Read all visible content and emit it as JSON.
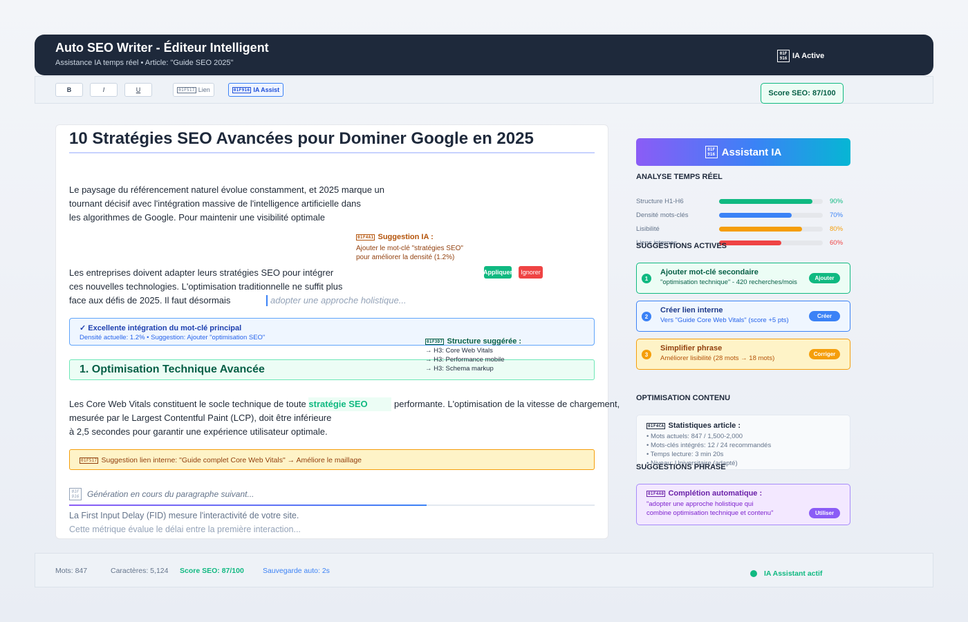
{
  "app": {
    "title": "Auto SEO Writer - Éditeur Intelligent",
    "subtitle": "Assistance IA temps réel • Article: \"Guide SEO 2025\"",
    "status_icon": "robot-icon",
    "status_glyph": "01F916",
    "status_label": "IA Active"
  },
  "toolbar": {
    "bold": "B",
    "italic": "I",
    "underline": "U",
    "link_glyph": "01F517",
    "link_label": "Lien",
    "ia_glyph": "01F916",
    "ia_label": "IA Assist",
    "seo_score": "Score SEO: 87/100"
  },
  "editor": {
    "title": "10 Stratégies SEO Avancées pour Dominer Google en 2025",
    "para1": [
      "Le paysage du référencement naturel évolue constamment, et 2025 marque un",
      "tournant décisif avec l'intégration massive de l'intelligence artificielle dans",
      "les algorithmes de Google. Pour maintenir une visibilité optimale"
    ],
    "para2": [
      "Les entreprises doivent adapter leurs stratégies SEO pour intégrer",
      "ces nouvelles technologies. L'optimisation traditionnelle ne suffit plus",
      "face aux défis de 2025. Il faut désormais"
    ],
    "ghost_completion": "adopter une approche holistique...",
    "ai_suggestion": {
      "glyph": "01F4A1",
      "title": "Suggestion IA :",
      "line1": "Ajouter le mot-clé \"stratégies SEO\"",
      "line2": "pour améliorer la densité (1.2%)",
      "apply": "Appliquer",
      "ignore": "Ignorer"
    },
    "keyword_box": {
      "title": "✓ Excellente intégration du mot-clé principal",
      "detail": "Densité actuelle: 1.2% • Suggestion: Ajouter \"optimisation SEO\""
    },
    "structure_pop": {
      "glyph": "01F3D7",
      "title": "Structure suggérée :",
      "items": [
        "→ H3: Core Web Vitals",
        "→ H3: Performance mobile",
        "→ H3: Schema markup"
      ]
    },
    "h2": "1. Optimisation Technique Avancée",
    "para3": {
      "line1_before": "Les Core Web Vitals constituent le socle technique de toute ",
      "keyword": "stratégie SEO",
      "line1_after": " performante. L'optimisation de la vitesse de chargement,",
      "line2": "mesurée par le Largest Contentful Paint (LCP), doit être inférieure",
      "line3": "à 2,5 secondes pour garantir une expérience utilisateur optimale."
    },
    "link_suggestion": {
      "glyph": "01F517",
      "text": "Suggestion lien interne: \"Guide complet Core Web Vitals\" → Améliore le maillage"
    },
    "generation": {
      "glyph": "01F916",
      "status": "Génération en cours du paragraphe suivant...",
      "progress": 0.68,
      "line1": "La First Input Delay (FID) mesure l'interactivité de votre site.",
      "line2": "Cette métrique évalue le délai entre la première interaction..."
    }
  },
  "assistant": {
    "glyph": "01F916",
    "title": "Assistant IA",
    "analysis_title": "ANALYSE TEMPS RÉEL",
    "metrics": [
      {
        "label": "Structure H1-H6",
        "value": 90,
        "display": "90%",
        "color": "#10b981"
      },
      {
        "label": "Densité mots-clés",
        "value": 70,
        "display": "70%",
        "color": "#3b82f6"
      },
      {
        "label": "Lisibilité",
        "value": 80,
        "display": "80%",
        "color": "#f59e0b"
      },
      {
        "label": "Liens internes",
        "value": 60,
        "display": "60%",
        "color": "#ef4444"
      }
    ],
    "suggestions_title": "SUGGESTIONS ACTIVES",
    "suggestions": [
      {
        "num": "1",
        "title": "Ajouter mot-clé secondaire",
        "detail": "\"optimisation technique\" - 420 recherches/mois",
        "action": "Ajouter",
        "color": "#10b981",
        "bg": "#ecfdf5",
        "text": "#065f46",
        "detail_color": "#065f46"
      },
      {
        "num": "2",
        "title": "Créer lien interne",
        "detail": "Vers \"Guide Core Web Vitals\" (score +5 pts)",
        "action": "Créer",
        "color": "#3b82f6",
        "bg": "#eff6ff",
        "text": "#1e3a8a",
        "detail_color": "#2563eb"
      },
      {
        "num": "3",
        "title": "Simplifier phrase",
        "detail": "Améliorer lisibilité (28 mots → 18 mots)",
        "action": "Corriger",
        "color": "#f59e0b",
        "bg": "#fef3c7",
        "text": "#92400e",
        "detail_color": "#b45309"
      }
    ],
    "optim_title": "OPTIMISATION CONTENU",
    "stats": {
      "glyph": "01F4CA",
      "title": "Statistiques article :",
      "lines": [
        "• Mots actuels: 847 / 1,500-2,000",
        "• Mots-clés intégrés: 12 / 24 recommandés",
        "• Temps lecture: 3 min 20s",
        "• Niveau: Universitaire (adapté)"
      ]
    },
    "phrase_title": "SUGGESTIONS PHRASE",
    "completion": {
      "glyph": "01F4A0",
      "title": "Complétion automatique :",
      "line1": "\"adopter une approche holistique qui",
      "line2": "combine optimisation technique et contenu\"",
      "action": "Utiliser"
    }
  },
  "footer": {
    "words": "Mots: 847",
    "chars": "Caractères: 5,124",
    "score": "Score SEO: 87/100",
    "autosave": "Sauvegarde auto: 2s",
    "ia_status": "IA Assistant actif"
  }
}
